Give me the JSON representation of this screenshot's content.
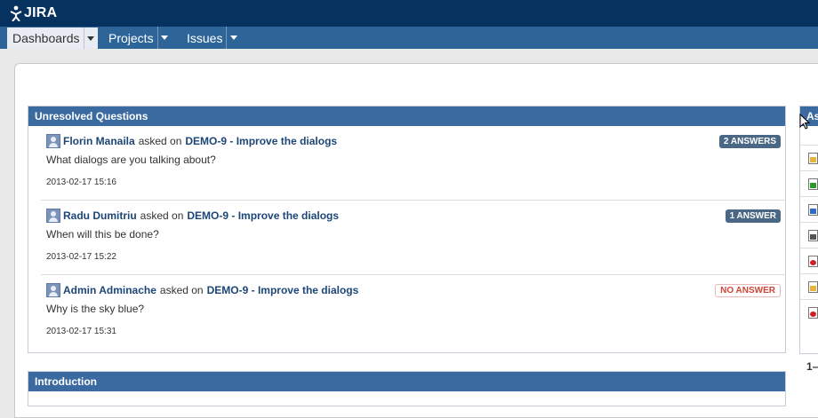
{
  "app": {
    "logo_text": "JIRA"
  },
  "nav": [
    {
      "label": "Dashboards",
      "active": true
    },
    {
      "label": "Projects",
      "active": false
    },
    {
      "label": "Issues",
      "active": false
    }
  ],
  "unresolved": {
    "title": "Unresolved Questions",
    "asked_text": "asked on",
    "questions": [
      {
        "author": "Florin Manaila",
        "issue": "DEMO-9 - Improve the dialogs",
        "body": "What dialogs are you talking about?",
        "date": "2013-02-17 15:16",
        "badge": "2 ANSWERS"
      },
      {
        "author": "Radu Dumitriu",
        "issue": "DEMO-9 - Improve the dialogs",
        "body": "When will this be done?",
        "date": "2013-02-17 15:22",
        "badge": "1 ANSWER"
      },
      {
        "author": "Admin Adminache",
        "issue": "DEMO-9 - Improve the dialogs",
        "body": "Why is the sky blue?",
        "date": "2013-02-17 15:31",
        "badge": "NO ANSWER"
      }
    ]
  },
  "introduction": {
    "title": "Introduction"
  },
  "side_gadget": {
    "title_fragment": "As",
    "pager_fragment": "1–",
    "icons": [
      "issue-icon",
      "add-icon",
      "link-icon",
      "info-icon",
      "bug-icon",
      "issue-icon",
      "bug-icon"
    ]
  },
  "colors": {
    "topbar": "#06325f",
    "navbar": "#2e6599",
    "gadget_header": "#3b6aa0",
    "link": "#1c4677",
    "no_answer": "#d04437"
  }
}
